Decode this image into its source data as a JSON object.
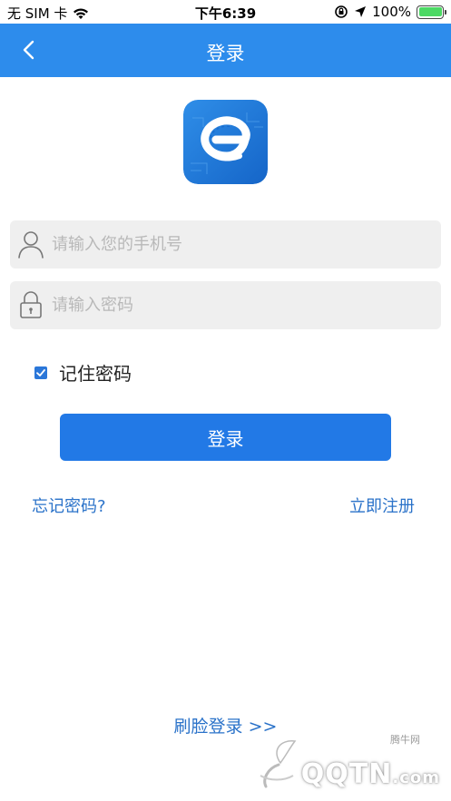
{
  "status_bar": {
    "carrier": "无 SIM 卡",
    "time": "下午6:39",
    "battery": "100%"
  },
  "nav": {
    "title": "登录"
  },
  "login_form": {
    "phone_placeholder": "请输入您的手机号",
    "password_placeholder": "请输入密码",
    "remember_label": "记住密码",
    "remember_checked": true,
    "submit_label": "登录"
  },
  "links": {
    "forgot_password": "忘记密码?",
    "register": "立即注册",
    "face_login": "刷脸登录 >>"
  },
  "watermark": {
    "site_name": "腾牛网",
    "brand": "QQTN",
    "suffix": ".com"
  },
  "colors": {
    "nav_bg": "#2d8cec",
    "button_bg": "#2279e6",
    "link": "#2a72c9",
    "field_bg": "#efefef"
  }
}
